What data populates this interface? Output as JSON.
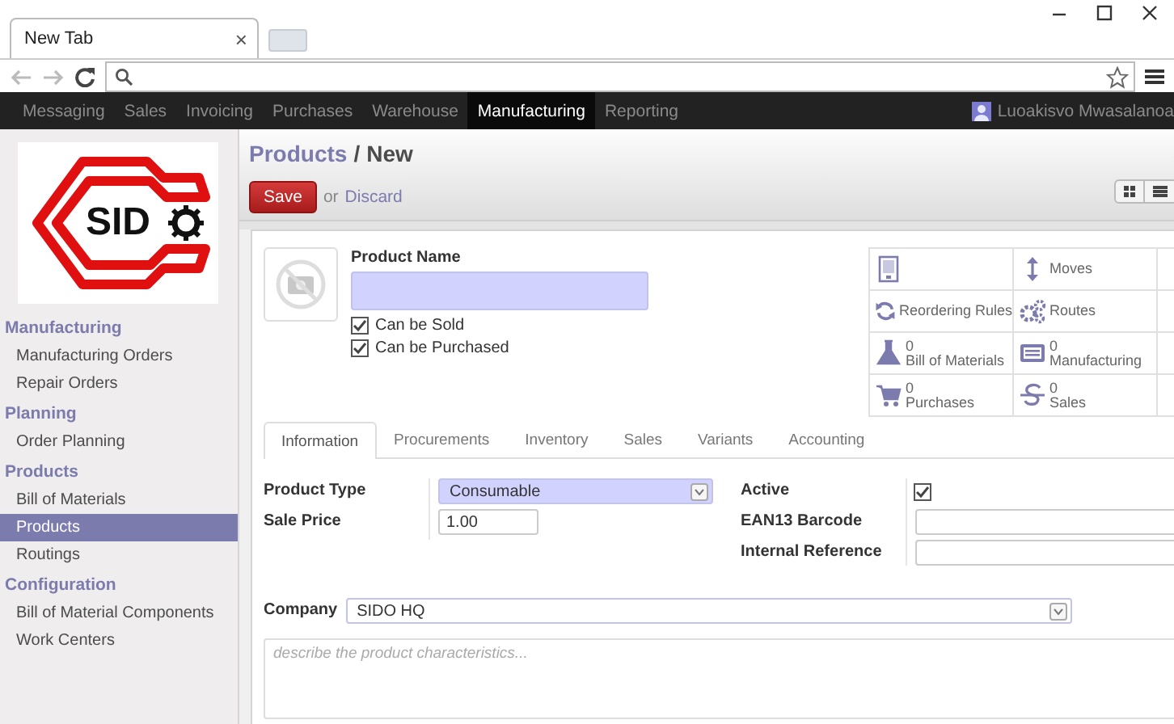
{
  "browser": {
    "tab_title": "New Tab",
    "close_tab": "×"
  },
  "nav": {
    "items": [
      {
        "label": "Messaging",
        "selected": false
      },
      {
        "label": "Sales",
        "selected": false
      },
      {
        "label": "Invoicing",
        "selected": false
      },
      {
        "label": "Purchases",
        "selected": false
      },
      {
        "label": "Warehouse",
        "selected": false
      },
      {
        "label": "Manufacturing",
        "selected": true
      },
      {
        "label": "Reporting",
        "selected": false
      }
    ],
    "user": "Luoakisvo Mwasalanoa"
  },
  "sidebar": {
    "logo_text": "SID",
    "sections": [
      {
        "title": "Manufacturing",
        "items": [
          {
            "label": "Manufacturing Orders",
            "selected": false
          },
          {
            "label": "Repair Orders",
            "selected": false
          }
        ]
      },
      {
        "title": "Planning",
        "items": [
          {
            "label": "Order Planning",
            "selected": false
          }
        ]
      },
      {
        "title": "Products",
        "items": [
          {
            "label": "Bill of Materials",
            "selected": false
          },
          {
            "label": "Products",
            "selected": true
          },
          {
            "label": "Routings",
            "selected": false
          }
        ]
      },
      {
        "title": "Configuration",
        "items": [
          {
            "label": "Bill of Material Components",
            "selected": false
          },
          {
            "label": "Work Centers",
            "selected": false
          }
        ]
      }
    ]
  },
  "breadcrumb": {
    "parent": "Products",
    "separator": "/",
    "current": "New"
  },
  "actions": {
    "save": "Save",
    "or": "or",
    "discard": "Discard"
  },
  "form": {
    "name_label": "Product Name",
    "flags": [
      {
        "label": "Can be Sold",
        "checked": true
      },
      {
        "label": "Can be Purchased",
        "checked": true
      }
    ],
    "smart_buttons": [
      {
        "kind": "icon"
      },
      {
        "kind": "label",
        "label": "Moves"
      },
      {
        "kind": "label",
        "label": "Reordering Rules"
      },
      {
        "kind": "label",
        "label": "Routes"
      },
      {
        "kind": "stat",
        "count": "0",
        "label": "Bill of Materials"
      },
      {
        "kind": "stat",
        "count": "0",
        "label": "Manufacturing"
      },
      {
        "kind": "stat",
        "count": "0",
        "label": "Purchases"
      },
      {
        "kind": "stat",
        "count": "0",
        "label": "Sales"
      }
    ],
    "tabs": [
      {
        "label": "Information",
        "selected": true
      },
      {
        "label": "Procurements",
        "selected": false
      },
      {
        "label": "Inventory",
        "selected": false
      },
      {
        "label": "Sales",
        "selected": false
      },
      {
        "label": "Variants",
        "selected": false
      },
      {
        "label": "Accounting",
        "selected": false
      }
    ],
    "left_fields": [
      {
        "label": "Product Type",
        "kind": "select",
        "value": "Consumable",
        "required": true
      },
      {
        "label": "Sale Price",
        "kind": "input",
        "value": "1.00",
        "required": false
      }
    ],
    "right_fields": [
      {
        "label": "Active",
        "kind": "checkbox",
        "checked": true
      },
      {
        "label": "EAN13 Barcode",
        "kind": "input"
      },
      {
        "label": "Internal Reference",
        "kind": "input"
      }
    ],
    "company": {
      "label": "Company",
      "value": "SIDO HQ"
    },
    "description": {
      "placeholder": "describe the product characteristics..."
    }
  }
}
